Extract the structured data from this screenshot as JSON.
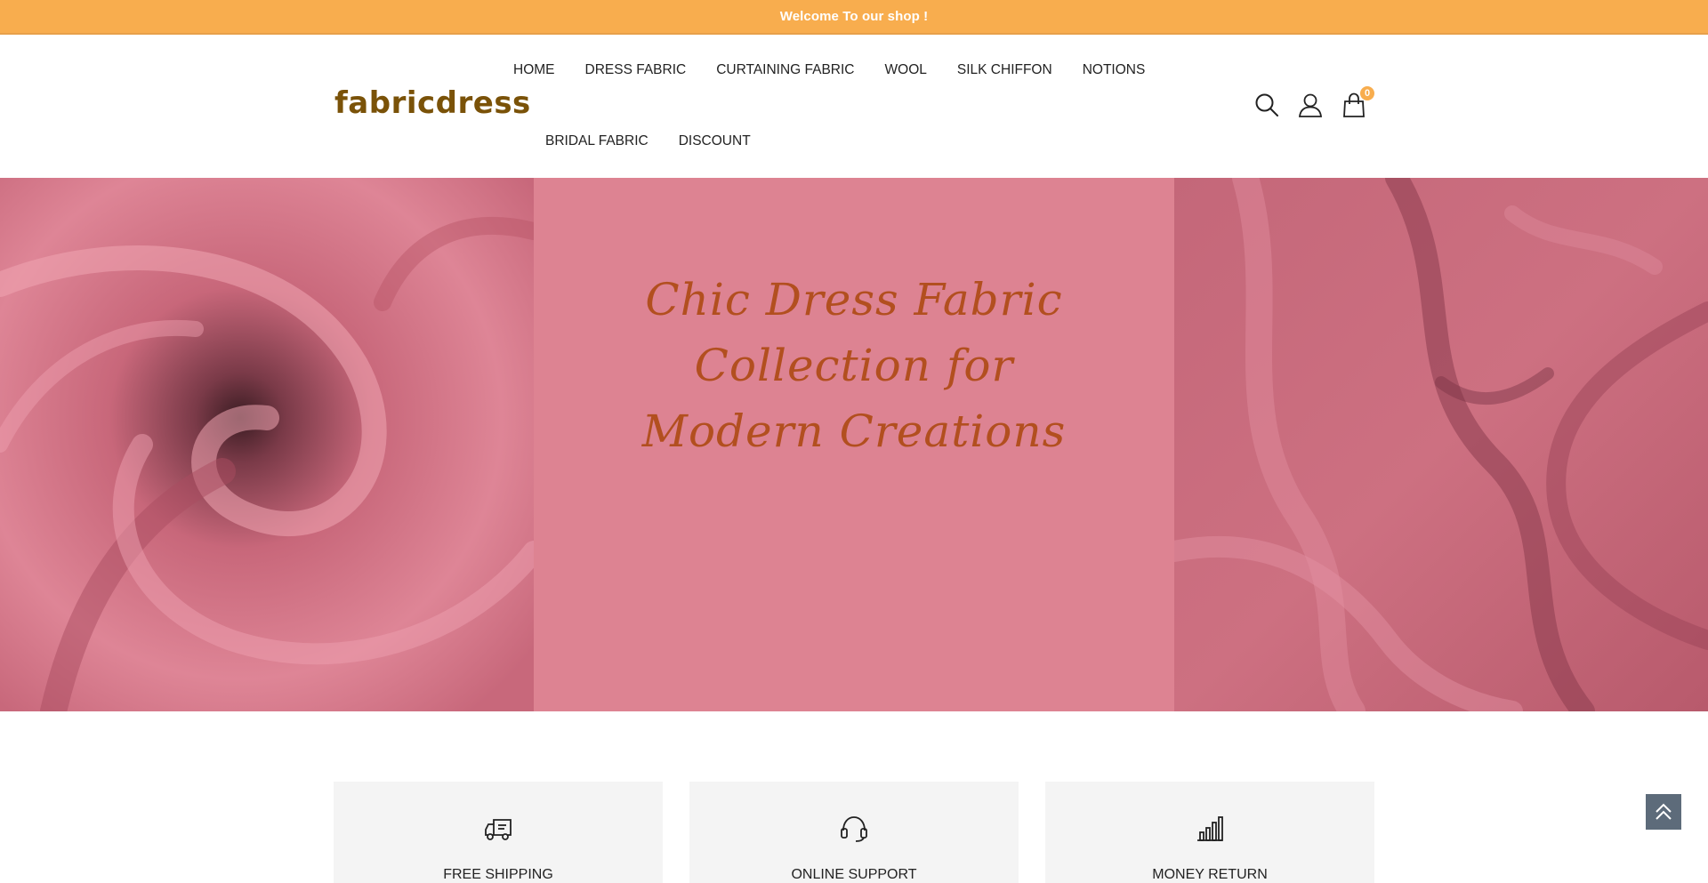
{
  "announcement": {
    "text": "Welcome To our shop !"
  },
  "header": {
    "logo": "fabricdress",
    "nav_row1": [
      "HOME",
      "DRESS FABRIC",
      "CURTAINING FABRIC",
      "WOOL",
      "SILK CHIFFON",
      "NOTIONS"
    ],
    "nav_row2": [
      "BRIDAL FABRIC",
      "DISCOUNT"
    ],
    "icons": [
      "search-icon",
      "account-icon",
      "cart-icon"
    ],
    "cart_count": "0"
  },
  "hero": {
    "title_line1": "Chic Dress Fabric Collection for",
    "title_line2": "Modern Creations",
    "colors": {
      "left_panel": "#d77487",
      "mid_panel": "#dd8392",
      "right_panel": "#c9667a",
      "title": "#b24f1f"
    }
  },
  "features": [
    {
      "icon": "truck-icon",
      "label": "FREE SHIPPING"
    },
    {
      "icon": "headset-icon",
      "label": "ONLINE SUPPORT"
    },
    {
      "icon": "bar-chart-icon",
      "label": "MONEY RETURN"
    }
  ],
  "colors": {
    "accent": "#f8ad4e",
    "logo": "#7a5208",
    "back_to_top": "#5d6b7a"
  }
}
